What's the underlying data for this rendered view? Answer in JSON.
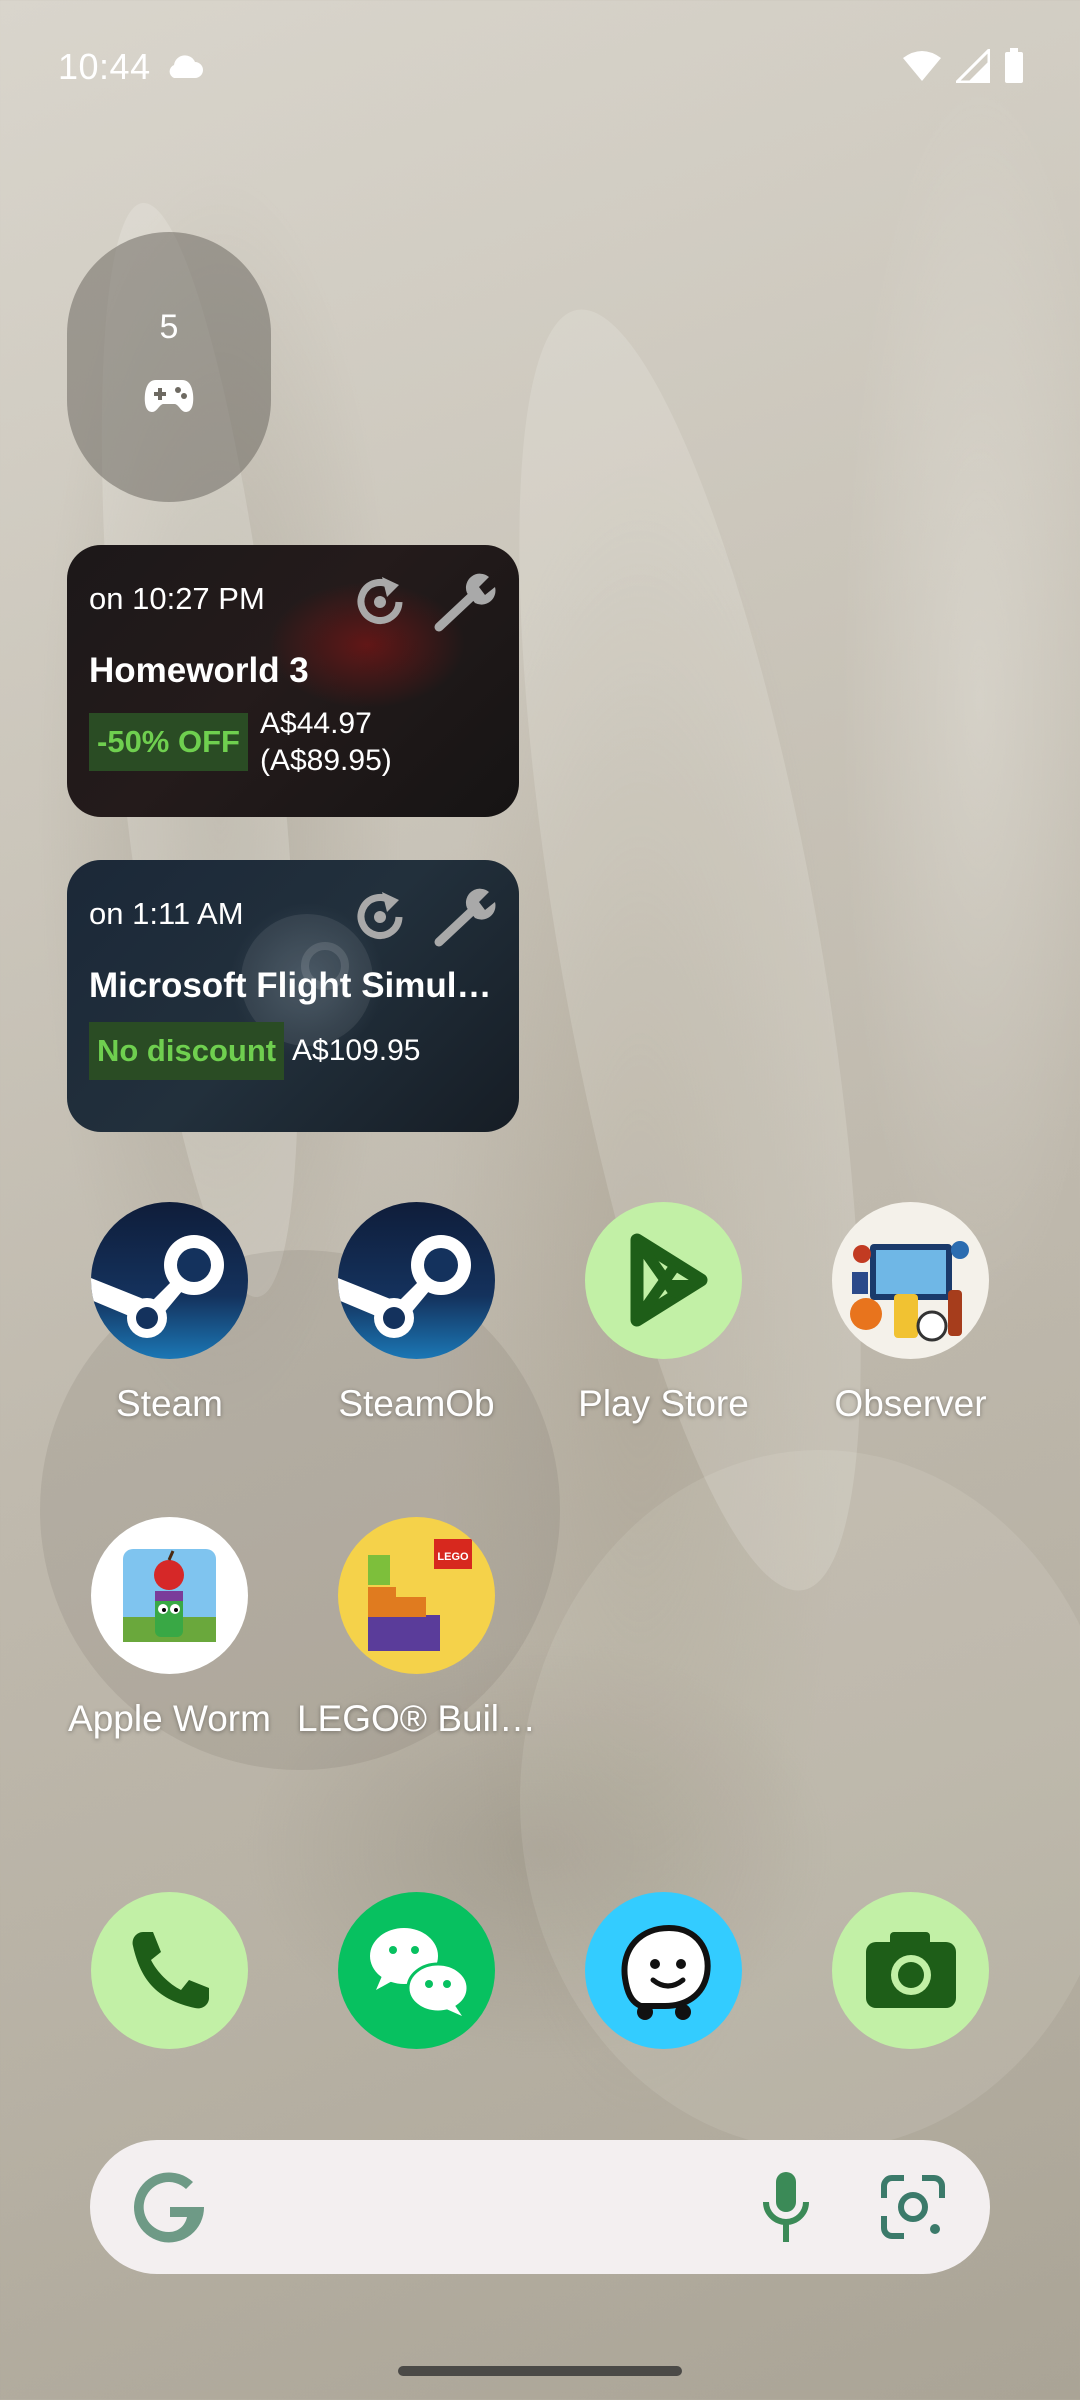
{
  "status_bar": {
    "time": "10:44",
    "icons": [
      "cloud-icon",
      "wifi-icon",
      "signal-icon",
      "battery-icon"
    ]
  },
  "game_pill_widget": {
    "count": "5",
    "icon": "gamepad-icon"
  },
  "steam_widgets": [
    {
      "time": "on 10:27 PM",
      "title": "Homeworld 3",
      "discount": "-50% OFF",
      "price": "A$44.97",
      "original_price": "(A$89.95)"
    },
    {
      "time": "on 1:11 AM",
      "title": "Microsoft Flight Simul…",
      "discount": "No discount",
      "price": "A$109.95"
    }
  ],
  "apps": [
    {
      "label": "Steam",
      "icon": "steam-icon"
    },
    {
      "label": "SteamOb",
      "icon": "steam-icon"
    },
    {
      "label": "Play Store",
      "icon": "play-store-icon"
    },
    {
      "label": "Observer",
      "icon": "observer-icon"
    },
    {
      "label": "Apple Worm",
      "icon": "apple-worm-icon"
    },
    {
      "label": "LEGO® Buil…",
      "icon": "lego-icon"
    }
  ],
  "dock": [
    "phone-icon",
    "wechat-icon",
    "waze-icon",
    "camera-icon"
  ],
  "search_bar": {
    "logo": "google-g-icon",
    "mic": "mic-icon",
    "lens": "google-lens-icon"
  },
  "colors": {
    "discount_text": "#6fcf4f",
    "discount_bg": "#2a4c24",
    "play_store_bg": "#c2f0a6",
    "wechat_bg": "#07c160",
    "waze_bg": "#33ccff"
  }
}
